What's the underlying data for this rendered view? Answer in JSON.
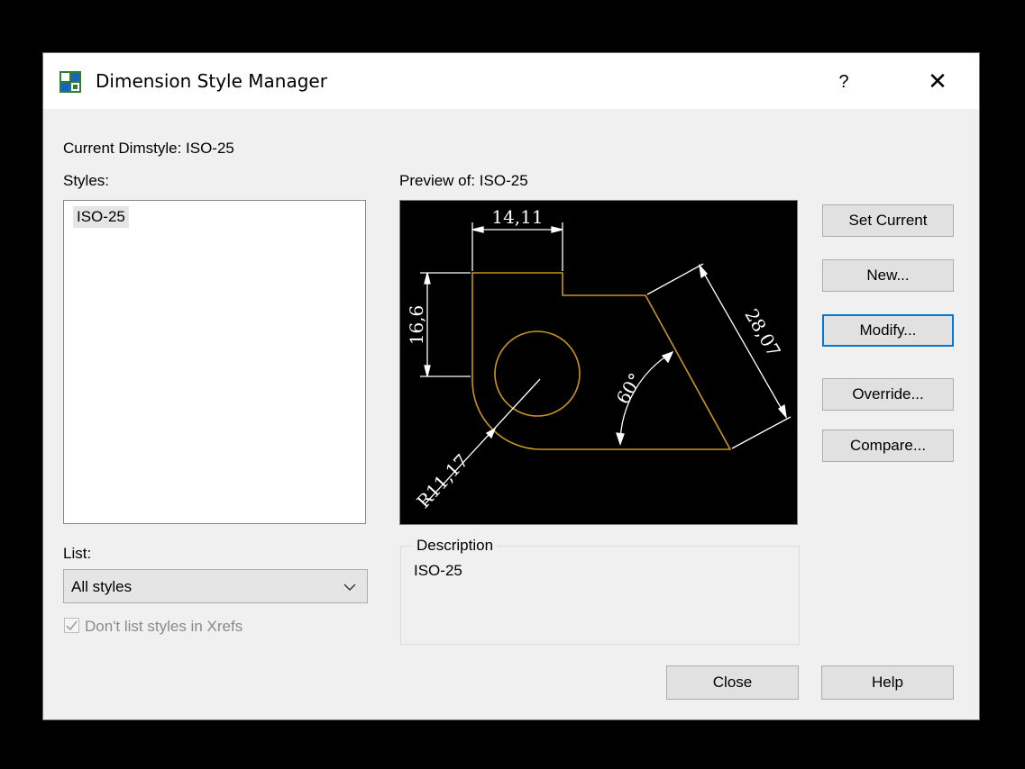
{
  "window": {
    "title": "Dimension Style Manager",
    "help_glyph": "?",
    "close_glyph": "✕",
    "icon": "dimension-style-icon"
  },
  "current_dimstyle": "Current Dimstyle: ISO-25",
  "styles": {
    "label": "Styles:",
    "items": [
      "ISO-25"
    ]
  },
  "preview": {
    "label": "Preview of: ISO-25",
    "dims": {
      "top": "14,11",
      "left": "16,6",
      "diagonal": "28,07",
      "angle": "60°",
      "radius": "R11,17"
    },
    "colors": {
      "geometry": "#c8961e",
      "dimension": "#ffffff",
      "background": "#000000"
    }
  },
  "list": {
    "label": "List:",
    "selected": "All styles",
    "xref_label": "Don't list styles in Xrefs",
    "xref_checked": true
  },
  "description": {
    "legend": "Description",
    "text": "ISO-25"
  },
  "buttons": {
    "set_current": "Set Current",
    "new": "New...",
    "modify": "Modify...",
    "override": "Override...",
    "compare": "Compare...",
    "close": "Close",
    "help": "Help"
  }
}
